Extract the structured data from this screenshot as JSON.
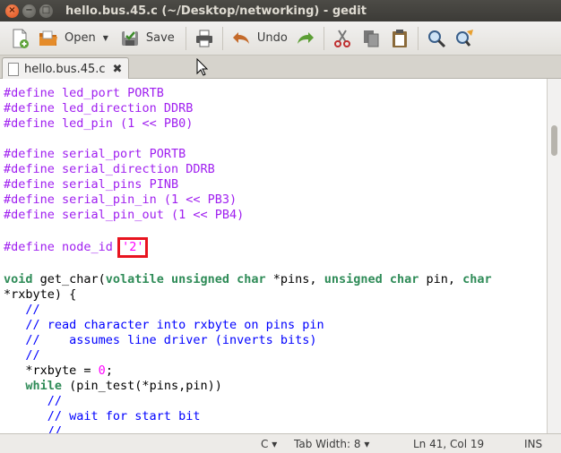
{
  "window": {
    "title": "hello.bus.45.c (~/Desktop/networking) - gedit",
    "close_glyph": "×",
    "min_glyph": "−",
    "max_glyph": "□"
  },
  "toolbar": {
    "open_label": "Open",
    "save_label": "Save",
    "undo_label": "Undo",
    "caret": "▼"
  },
  "tab": {
    "filename": "hello.bus.45.c",
    "close_glyph": "✖"
  },
  "code": {
    "line1": {
      "kw": "#define",
      "rest": " led_port PORTB"
    },
    "line2": {
      "kw": "#define",
      "rest": " led_direction DDRB"
    },
    "line3": {
      "kw": "#define",
      "rest": " led_pin (1 << PB0)"
    },
    "line5": {
      "kw": "#define",
      "rest": " serial_port PORTB"
    },
    "line6": {
      "kw": "#define",
      "rest": " serial_direction DDRB"
    },
    "line7": {
      "kw": "#define",
      "rest": " serial_pins PINB"
    },
    "line8": {
      "kw": "#define",
      "rest": " serial_pin_in (1 << PB3)"
    },
    "line9": {
      "kw": "#define",
      "rest": " serial_pin_out (1 << PB4)"
    },
    "line11": {
      "kw": "#define",
      "rest": " node_id ",
      "value": "'2'"
    },
    "line13": {
      "t1": "void",
      "a": " get_char(",
      "t2": "volatile",
      "b": " ",
      "t3": "unsigned",
      "c": " ",
      "t4": "char",
      "d": " *pins, ",
      "t5": "unsigned",
      "e": " ",
      "t6": "char",
      "f": " pin, ",
      "t7": "char"
    },
    "line14": "*rxbyte) {",
    "line15": "   //",
    "line16": "   // read character into rxbyte on pins pin",
    "line17": "   //    assumes line driver (inverts bits)",
    "line18": "   //",
    "line19": {
      "a": "   *rxbyte = ",
      "num": "0",
      "b": ";"
    },
    "line20": {
      "kw": "while",
      "rest": " (pin_test(*pins,pin))",
      "indent": "   "
    },
    "line21": "      //",
    "line22": "      // wait for start bit",
    "line23": "      //"
  },
  "status": {
    "language": "C",
    "tab_width": "Tab Width: 8",
    "position": "Ln 41, Col 19",
    "mode": "INS",
    "caret": "▾"
  },
  "colors": {
    "keyword": "#a020f0",
    "type": "#2e8b57",
    "comment": "#0000ff",
    "string": "#ff00ff",
    "highlight_box": "#e8141f"
  }
}
